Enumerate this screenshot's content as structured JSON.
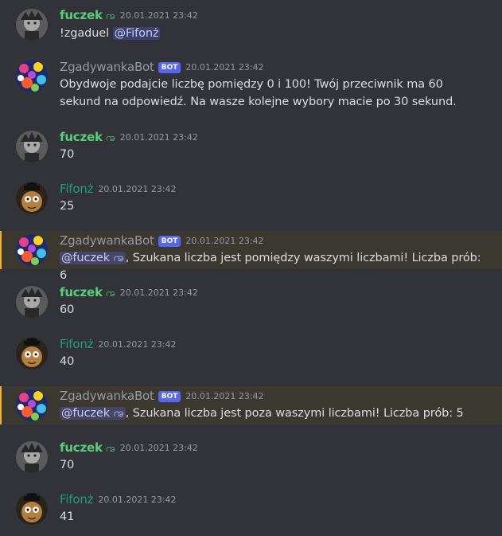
{
  "colors": {
    "background": "#313338",
    "user_green": "#57d07b",
    "user_teal": "#1f9e87",
    "bot_name": "#949ba4",
    "bot_tag": "#5865f2",
    "highlight_bg": "#3b382f",
    "highlight_bar": "#f0b232",
    "mention_bg": "#4a4f8c",
    "text": "#dbdee1",
    "timestamp": "#949ba4"
  },
  "messages": [
    {
      "author": "fuczek",
      "status_icon": "ꩠ",
      "timestamp": "20.01.2021 23:42",
      "text": "!zgaduel ",
      "mention": "@Fifonż",
      "text_after": ""
    },
    {
      "author": "ZgadywankaBot",
      "bot_tag": "BOT",
      "timestamp": "20.01.2021 23:42",
      "text": "Obydwoje podajcie liczbę pomiędzy 0 i 100! Twój przeciwnik ma 60 sekund na odpowiedź. Na wasze kolejne wybory macie po 30 sekund."
    },
    {
      "author": "fuczek",
      "status_icon": "ꩠ",
      "timestamp": "20.01.2021 23:42",
      "text": "70"
    },
    {
      "author": "Fifonż",
      "timestamp": "20.01.2021 23:42",
      "text": "25"
    },
    {
      "author": "ZgadywankaBot",
      "bot_tag": "BOT",
      "timestamp": "20.01.2021 23:42",
      "mention": "@fuczek ꩠ",
      "text": ", Szukana liczba jest pomiędzy waszymi liczbami! Liczba prób: 6"
    },
    {
      "author": "fuczek",
      "status_icon": "ꩠ",
      "timestamp": "20.01.2021 23:42",
      "text": "60"
    },
    {
      "author": "Fifonż",
      "timestamp": "20.01.2021 23:42",
      "text": "40"
    },
    {
      "author": "ZgadywankaBot",
      "bot_tag": "BOT",
      "timestamp": "20.01.2021 23:42",
      "mention": "@fuczek ꩠ",
      "text": ", Szukana liczba jest poza waszymi liczbami! Liczba prób: 5"
    },
    {
      "author": "fuczek",
      "status_icon": "ꩠ",
      "timestamp": "20.01.2021 23:42",
      "text": "70"
    },
    {
      "author": "Fifonż",
      "timestamp": "20.01.2021 23:42",
      "text": "41"
    }
  ]
}
